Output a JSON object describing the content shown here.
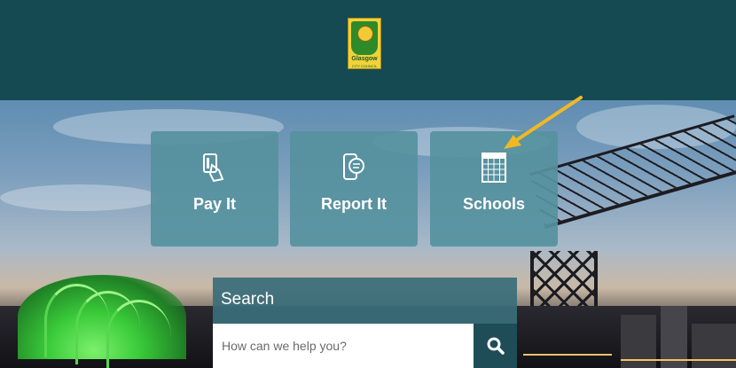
{
  "header": {
    "logo_text": "Glasgow",
    "logo_subtext": "CITY COUNCIL"
  },
  "tiles": [
    {
      "label": "Pay It",
      "icon": "card-payment-icon"
    },
    {
      "label": "Report It",
      "icon": "phone-chat-icon"
    },
    {
      "label": "Schools",
      "icon": "calendar-grid-icon"
    }
  ],
  "annotation": {
    "icon": "arrow-icon",
    "color": "#f2b824"
  },
  "search": {
    "title": "Search",
    "placeholder": "How can we help you?",
    "button_icon": "search-icon"
  },
  "colors": {
    "header_bg": "#154a52",
    "tile_bg": "#56919e",
    "search_bg": "#3a6e7a",
    "search_button_bg": "#1f4d57"
  }
}
